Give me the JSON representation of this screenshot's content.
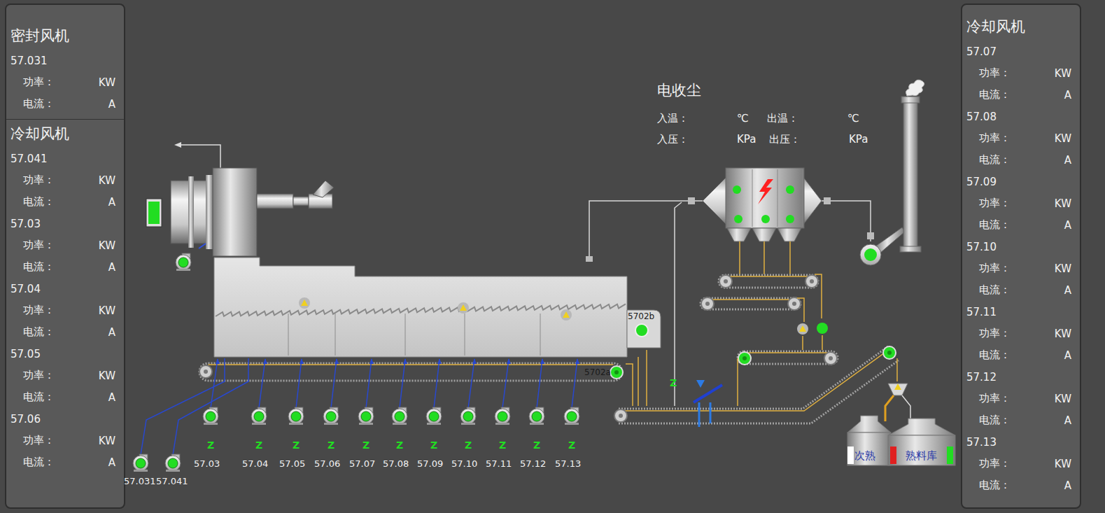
{
  "left_panel": {
    "sections": [
      {
        "title": "密封风机",
        "fans": [
          {
            "id": "57.031",
            "power_label": "功率：",
            "power_unit": "KW",
            "current_label": "电流：",
            "current_unit": "A"
          }
        ]
      },
      {
        "title": "冷却风机",
        "fans": [
          {
            "id": "57.041",
            "power_label": "功率：",
            "power_unit": "KW",
            "current_label": "电流：",
            "current_unit": "A"
          },
          {
            "id": "57.03",
            "power_label": "功率：",
            "power_unit": "KW",
            "current_label": "电流：",
            "current_unit": "A"
          },
          {
            "id": "57.04",
            "power_label": "功率：",
            "power_unit": "KW",
            "current_label": "电流：",
            "current_unit": "A"
          },
          {
            "id": "57.05",
            "power_label": "功率：",
            "power_unit": "KW",
            "current_label": "电流：",
            "current_unit": "A"
          },
          {
            "id": "57.06",
            "power_label": "功率：",
            "power_unit": "KW",
            "current_label": "电流：",
            "current_unit": "A"
          }
        ]
      }
    ]
  },
  "right_panel": {
    "sections": [
      {
        "title": "冷却风机",
        "fans": [
          {
            "id": "57.07",
            "power_label": "功率：",
            "power_unit": "KW",
            "current_label": "电流：",
            "current_unit": "A"
          },
          {
            "id": "57.08",
            "power_label": "功率：",
            "power_unit": "KW",
            "current_label": "电流：",
            "current_unit": "A"
          },
          {
            "id": "57.09",
            "power_label": "功率：",
            "power_unit": "KW",
            "current_label": "电流：",
            "current_unit": "A"
          },
          {
            "id": "57.10",
            "power_label": "功率：",
            "power_unit": "KW",
            "current_label": "电流：",
            "current_unit": "A"
          },
          {
            "id": "57.11",
            "power_label": "功率：",
            "power_unit": "KW",
            "current_label": "电流：",
            "current_unit": "A"
          },
          {
            "id": "57.12",
            "power_label": "功率：",
            "power_unit": "KW",
            "current_label": "电流：",
            "current_unit": "A"
          },
          {
            "id": "57.13",
            "power_label": "功率：",
            "power_unit": "KW",
            "current_label": "电流：",
            "current_unit": "A"
          }
        ]
      }
    ]
  },
  "precipitator": {
    "title": "电收尘",
    "inlet_temp_label": "入温：",
    "inlet_temp_unit": "℃",
    "outlet_temp_label": "出温：",
    "outlet_temp_unit": "℃",
    "inlet_pressure_label": "入压：",
    "inlet_pressure_unit": "KPa",
    "outlet_pressure_label": "出压：",
    "outlet_pressure_unit": "KPa",
    "lights": [
      {
        "color": "#22dd22"
      },
      {
        "color": "#22dd22"
      },
      {
        "color": "#22dd22"
      },
      {
        "color": "#22dd22"
      }
    ]
  },
  "seal_fans": [
    {
      "label": "57.031",
      "running": true
    },
    {
      "label": "57.041",
      "running": true
    }
  ],
  "cooling_fans": [
    {
      "label": "57.03",
      "mode": "Z",
      "running": true
    },
    {
      "label": "57.04",
      "mode": "Z",
      "running": true
    },
    {
      "label": "57.05",
      "mode": "Z",
      "running": true
    },
    {
      "label": "57.06",
      "mode": "Z",
      "running": true
    },
    {
      "label": "57.07",
      "mode": "Z",
      "running": true
    },
    {
      "label": "57.08",
      "mode": "Z",
      "running": true
    },
    {
      "label": "57.09",
      "mode": "Z",
      "running": true
    },
    {
      "label": "57.10",
      "mode": "Z",
      "running": true
    },
    {
      "label": "57.11",
      "mode": "Z",
      "running": true
    },
    {
      "label": "57.12",
      "mode": "Z",
      "running": true
    },
    {
      "label": "57.13",
      "mode": "Z",
      "running": true
    }
  ],
  "crusher": {
    "label": "5702b",
    "running": true
  },
  "grate_conveyor": {
    "label": "5702a",
    "running": true
  },
  "conveyor_mode": "Z",
  "silos": [
    {
      "label": "次熟",
      "indicators": [
        {
          "color": "#ffffff"
        }
      ]
    },
    {
      "label": "熟料库",
      "indicators": [
        {
          "color": "#e02020"
        },
        {
          "color": "#22dd22"
        }
      ]
    }
  ]
}
